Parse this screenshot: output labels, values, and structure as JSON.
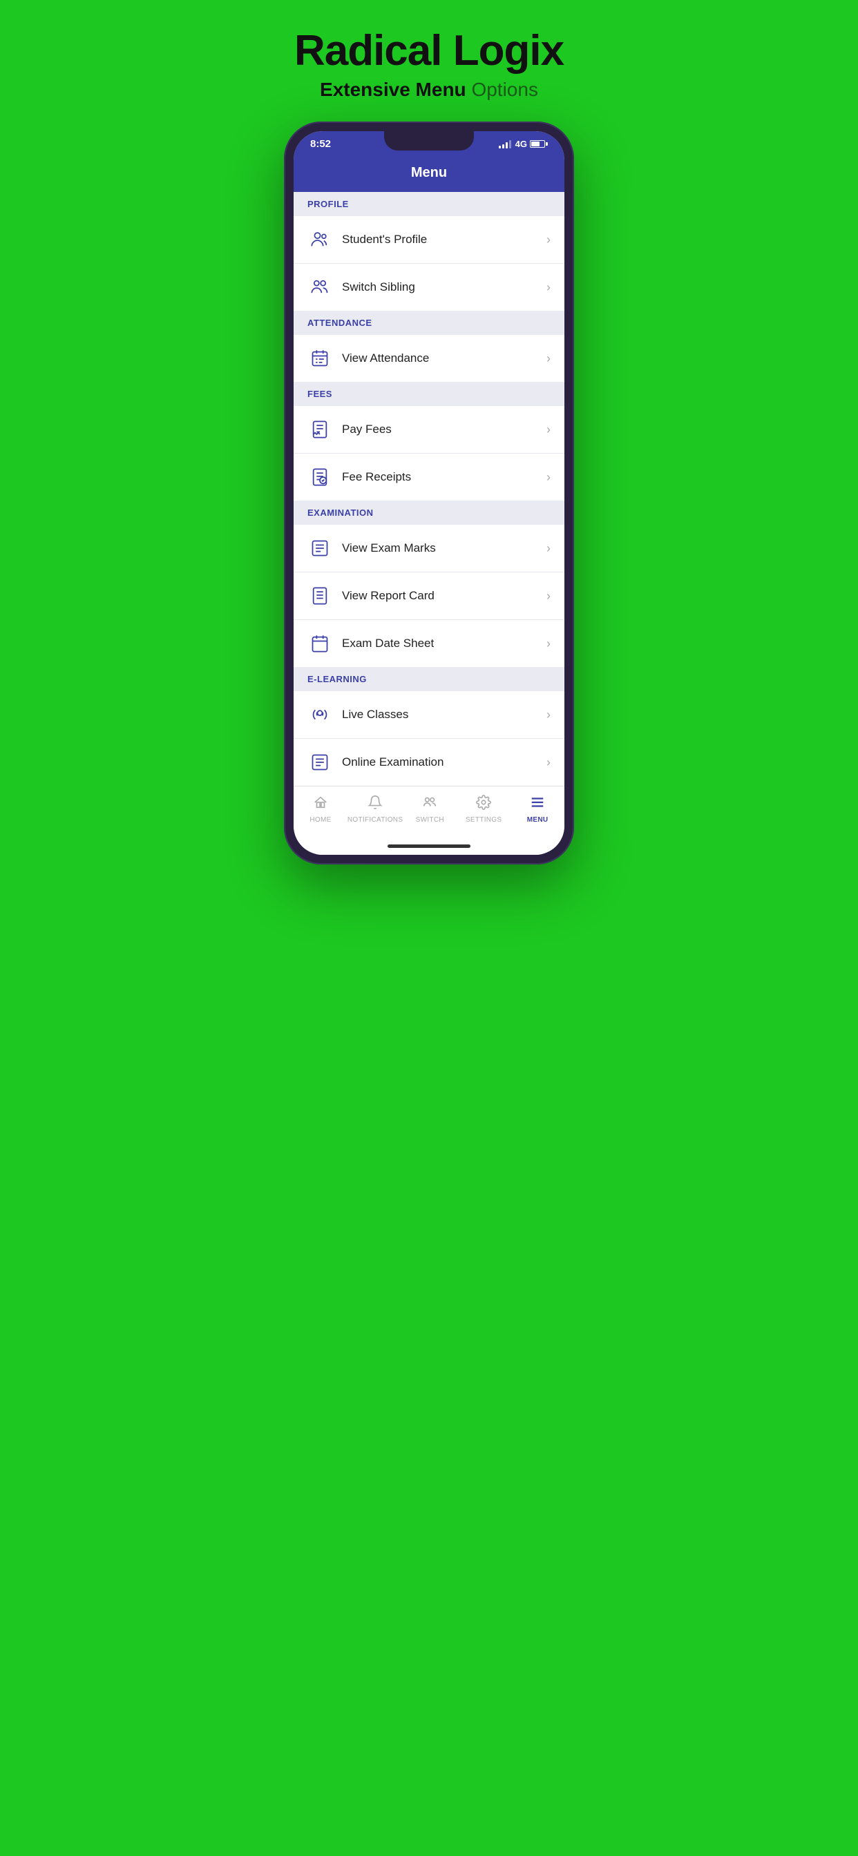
{
  "header": {
    "title": "Radical Logix",
    "subtitle_bold": "Extensive  Menu",
    "subtitle_normal": " Options"
  },
  "phone": {
    "status_time": "8:52",
    "signal": "4G",
    "app_title": "Menu"
  },
  "sections": [
    {
      "id": "profile",
      "label": "PROFILE",
      "items": [
        {
          "id": "students-profile",
          "label": "Student's Profile",
          "icon": "person"
        },
        {
          "id": "switch-sibling",
          "label": "Switch Sibling",
          "icon": "people"
        }
      ]
    },
    {
      "id": "attendance",
      "label": "ATTENDANCE",
      "items": [
        {
          "id": "view-attendance",
          "label": "View Attendance",
          "icon": "calendar-check"
        }
      ]
    },
    {
      "id": "fees",
      "label": "FEES",
      "items": [
        {
          "id": "pay-fees",
          "label": "Pay Fees",
          "icon": "receipt"
        },
        {
          "id": "fee-receipts",
          "label": "Fee Receipts",
          "icon": "doc"
        }
      ]
    },
    {
      "id": "examination",
      "label": "EXAMINATION",
      "items": [
        {
          "id": "view-exam-marks",
          "label": "View Exam Marks",
          "icon": "marks"
        },
        {
          "id": "view-report-card",
          "label": "View Report Card",
          "icon": "report"
        },
        {
          "id": "exam-date-sheet",
          "label": "Exam Date Sheet",
          "icon": "datesheet"
        }
      ]
    },
    {
      "id": "elearning",
      "label": "E-LEARNING",
      "items": [
        {
          "id": "live-classes",
          "label": "Live Classes",
          "icon": "live"
        },
        {
          "id": "online-examination",
          "label": "Online Examination",
          "icon": "online-exam"
        }
      ]
    }
  ],
  "bottom_nav": [
    {
      "id": "home",
      "label": "HOME",
      "icon": "home",
      "active": false
    },
    {
      "id": "notifications",
      "label": "NOTIFICATIONS",
      "icon": "bell",
      "active": false
    },
    {
      "id": "switch",
      "label": "SWITCH",
      "icon": "switch",
      "active": false
    },
    {
      "id": "settings",
      "label": "SETTINGS",
      "icon": "settings",
      "active": false
    },
    {
      "id": "menu",
      "label": "MENU",
      "icon": "menu",
      "active": true
    }
  ]
}
